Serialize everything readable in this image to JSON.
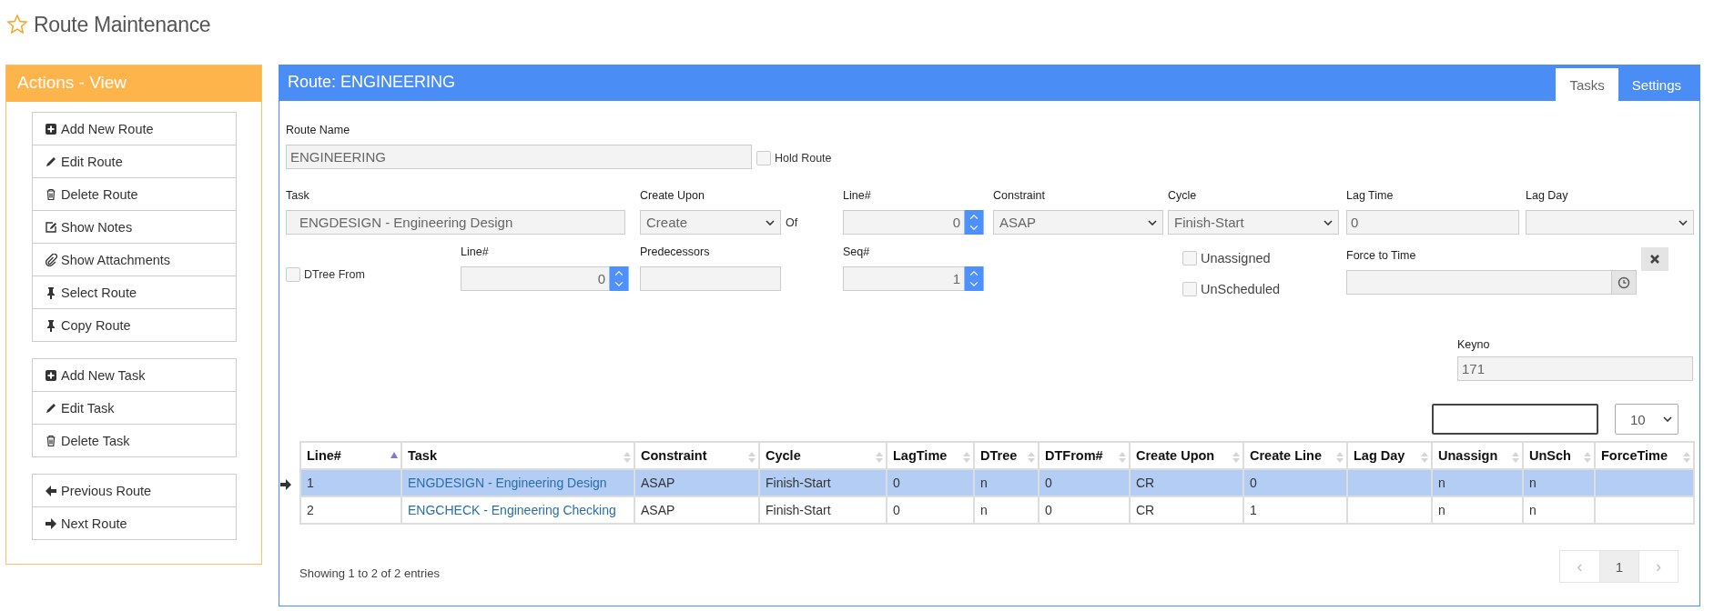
{
  "page_title": "Route Maintenance",
  "actions": {
    "title": "Actions - View",
    "groups": [
      [
        {
          "kind": "add",
          "label": "Add New Route"
        },
        {
          "kind": "edit",
          "label": "Edit Route"
        },
        {
          "kind": "delete",
          "label": "Delete Route"
        },
        {
          "kind": "notes",
          "label": "Show Notes"
        },
        {
          "kind": "attach",
          "label": "Show Attachments"
        },
        {
          "kind": "pin",
          "label": "Select Route"
        },
        {
          "kind": "pin",
          "label": "Copy Route"
        }
      ],
      [
        {
          "kind": "add",
          "label": "Add New Task"
        },
        {
          "kind": "edit",
          "label": "Edit Task"
        },
        {
          "kind": "delete",
          "label": "Delete Task"
        }
      ],
      [
        {
          "kind": "previous",
          "label": "Previous Route"
        },
        {
          "kind": "next",
          "label": "Next Route"
        }
      ]
    ]
  },
  "panel": {
    "title": "Route: ENGINEERING",
    "tabs": [
      {
        "label": "Tasks",
        "selected": true
      },
      {
        "label": "Settings",
        "selected": false
      }
    ]
  },
  "form": {
    "route_name": {
      "label": "Route Name",
      "value": "ENGINEERING"
    },
    "hold_route": {
      "label": "Hold Route",
      "checked": false
    },
    "task": {
      "label": "Task",
      "value": "ENGDESIGN - Engineering Design"
    },
    "create_upon": {
      "label": "Create Upon",
      "value": "Create",
      "suffix": "Of"
    },
    "line": {
      "label": "Line#",
      "value": "0"
    },
    "constraint": {
      "label": "Constraint",
      "value": "ASAP"
    },
    "cycle": {
      "label": "Cycle",
      "value": "Finish-Start"
    },
    "lag_time": {
      "label": "Lag Time",
      "value": "0"
    },
    "lag_day": {
      "label": "Lag Day"
    },
    "dtree_from": {
      "label": "DTree From",
      "checked": false
    },
    "dtree_line": {
      "label": "Line#",
      "value": "0"
    },
    "predecessors": {
      "label": "Predecessors"
    },
    "seq": {
      "label": "Seq#",
      "value": "1"
    },
    "unassigned": {
      "label": "Unassigned",
      "checked": false
    },
    "unscheduled": {
      "label": "UnScheduled",
      "checked": false
    },
    "force_to_time": {
      "label": "Force to Time"
    },
    "keyno": {
      "label": "Keyno",
      "value": "171"
    }
  },
  "table": {
    "page_length": "10",
    "columns": [
      {
        "label": "Line#",
        "sorted": true,
        "kind": "text"
      },
      {
        "label": "Task",
        "sorted": false,
        "kind": "link"
      },
      {
        "label": "Constraint",
        "sorted": false,
        "kind": "text"
      },
      {
        "label": "Cycle",
        "sorted": false,
        "kind": "text"
      },
      {
        "label": "LagTime",
        "sorted": false,
        "kind": "text"
      },
      {
        "label": "DTree",
        "sorted": false,
        "kind": "text"
      },
      {
        "label": "DTFrom#",
        "sorted": false,
        "kind": "text"
      },
      {
        "label": "Create Upon",
        "sorted": false,
        "kind": "text"
      },
      {
        "label": "Create Line",
        "sorted": false,
        "kind": "text"
      },
      {
        "label": "Lag Day",
        "sorted": false,
        "kind": "text"
      },
      {
        "label": "Unassign",
        "sorted": false,
        "kind": "text"
      },
      {
        "label": "UnSch",
        "sorted": false,
        "kind": "text"
      },
      {
        "label": "ForceTime",
        "sorted": false,
        "kind": "text"
      }
    ],
    "rows": [
      {
        "selected": true,
        "cells": [
          "1",
          "ENGDESIGN - Engineering Design",
          "ASAP",
          "Finish-Start",
          "0",
          "n",
          "0",
          "CR",
          "0",
          "",
          "n",
          "n",
          ""
        ]
      },
      {
        "selected": false,
        "cells": [
          "2",
          "ENGCHECK - Engineering Checking",
          "ASAP",
          "Finish-Start",
          "0",
          "n",
          "0",
          "CR",
          "1",
          "",
          "n",
          "n",
          ""
        ]
      }
    ],
    "info": "Showing 1 to 2 of 2 entries",
    "pagination": {
      "previous": "‹",
      "pages": [
        {
          "label": "1",
          "selected": true
        }
      ],
      "next": "›"
    }
  }
}
